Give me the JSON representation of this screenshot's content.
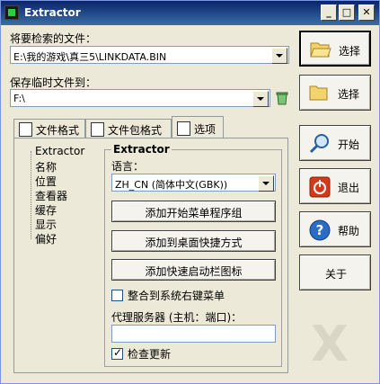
{
  "window": {
    "title": "Extractor"
  },
  "source": {
    "label": "将要检索的文件：",
    "value": "E:\\我的游戏\\真三5\\LINKDATA.BIN",
    "select_label": "选择"
  },
  "temp": {
    "label": "保存临时文件到：",
    "value": "F:\\",
    "select_label": "选择"
  },
  "tabs": [
    {
      "label": "文件格式"
    },
    {
      "label": "文件包格式"
    },
    {
      "label": "选项"
    }
  ],
  "tree": [
    "Extractor",
    "名称",
    "位置",
    "查看器",
    "缓存",
    "显示",
    "偏好"
  ],
  "options": {
    "group_title": "Extractor",
    "language_label": "语言：",
    "language_value": "ZH_CN (简体中文(GBK))",
    "btn_start_menu": "添加开始菜单程序组",
    "btn_desktop": "添加到桌面快捷方式",
    "btn_quicklaunch": "添加快速启动栏图标",
    "context_menu_label": "整合到系统右键菜单",
    "context_menu_checked": false,
    "proxy_label": "代理服务器 (主机：端口)：",
    "proxy_value": "",
    "update_label": "检查更新",
    "update_checked": true
  },
  "side_buttons": {
    "start": "开始",
    "exit": "退出",
    "help": "帮助",
    "about": "关于"
  },
  "watermark": {
    "letter": "X"
  }
}
